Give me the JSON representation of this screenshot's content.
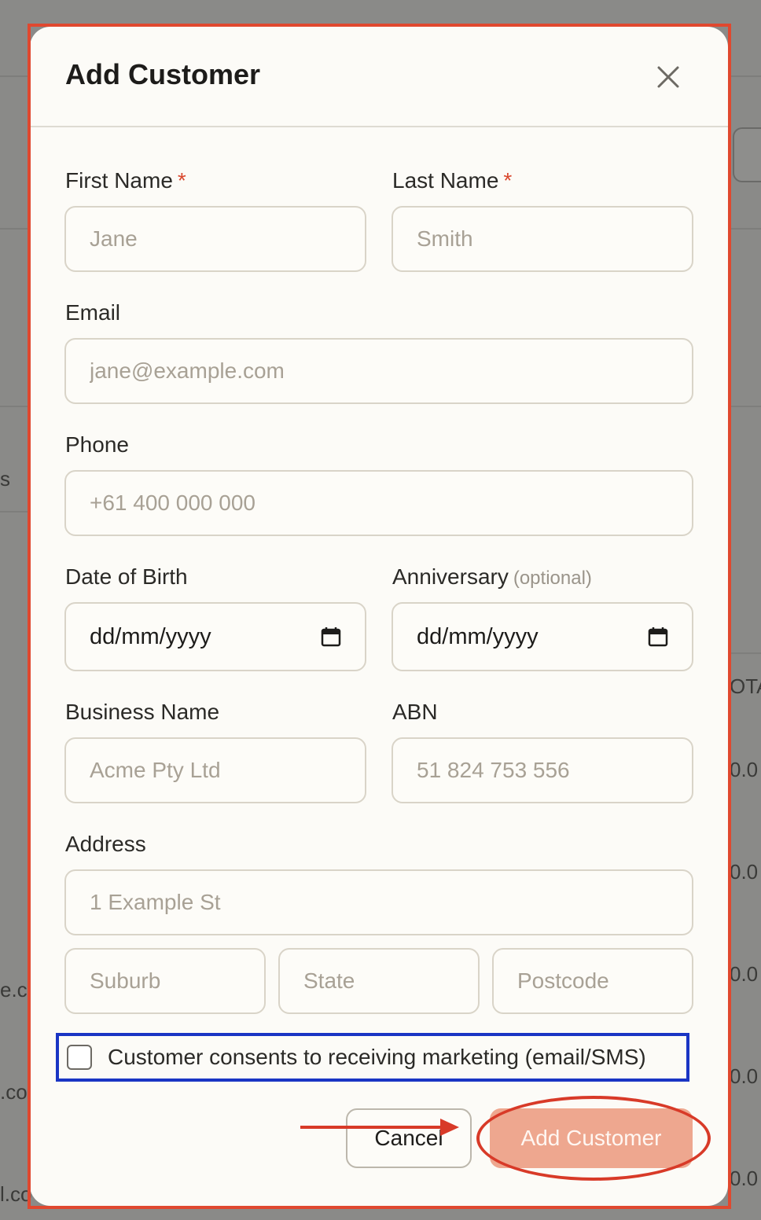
{
  "background": {
    "fragments": [
      "s",
      "OTA",
      "0.0",
      "0.0",
      "e.co",
      "0.0",
      ".co",
      "0.0",
      "l.co",
      "0.0"
    ]
  },
  "dialog": {
    "title": "Add Customer",
    "close_icon": "close-icon",
    "fields": {
      "first_name": {
        "label": "First Name",
        "required": "*",
        "placeholder": "Jane"
      },
      "last_name": {
        "label": "Last Name",
        "required": "*",
        "placeholder": "Smith"
      },
      "email": {
        "label": "Email",
        "placeholder": "jane@example.com"
      },
      "phone": {
        "label": "Phone",
        "placeholder": "+61 400 000 000"
      },
      "dob": {
        "label": "Date of Birth",
        "value": "dd/mm/yyyy"
      },
      "anniversary": {
        "label": "Anniversary",
        "optional": "(optional)",
        "value": "dd/mm/yyyy"
      },
      "business_name": {
        "label": "Business Name",
        "placeholder": "Acme Pty Ltd"
      },
      "abn": {
        "label": "ABN",
        "placeholder": "51 824 753 556"
      },
      "address": {
        "label": "Address",
        "placeholder": "1 Example St"
      },
      "suburb": {
        "placeholder": "Suburb"
      },
      "state": {
        "placeholder": "State"
      },
      "postcode": {
        "placeholder": "Postcode"
      }
    },
    "consent": {
      "label": "Customer consents to receiving marketing (email/SMS)",
      "checked": false
    },
    "actions": {
      "cancel": "Cancel",
      "submit": "Add Customer"
    }
  },
  "colors": {
    "annotation_red": "#e0482f",
    "annotation_blue": "#1a35c4",
    "submit_button": "#eea78f",
    "required_star": "#d9482e"
  }
}
